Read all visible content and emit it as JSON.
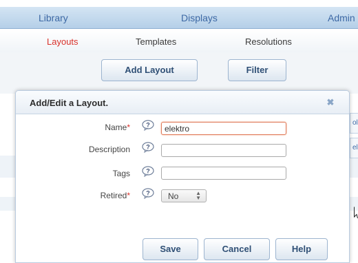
{
  "topnav": {
    "items": [
      "Library",
      "Displays",
      "Admin"
    ]
  },
  "subnav": {
    "items": [
      "Layouts",
      "Templates",
      "Resolutions"
    ],
    "active": "Layouts"
  },
  "actions": {
    "add_layout": "Add Layout",
    "filter": "Filter"
  },
  "dialog": {
    "title": "Add/Edit a Layout.",
    "close": "✖",
    "fields": {
      "name": {
        "label": "Name",
        "required": "*",
        "value": "elektro"
      },
      "description": {
        "label": "Description",
        "value": ""
      },
      "tags": {
        "label": "Tags",
        "value": ""
      },
      "retired": {
        "label": "Retired",
        "required": "*",
        "value": "No"
      }
    },
    "buttons": {
      "save": "Save",
      "cancel": "Cancel",
      "help": "Help"
    }
  },
  "background": {
    "tab1": "ol",
    "tab2": "el"
  },
  "icons": {
    "help": "help-question-icon",
    "close": "close-icon",
    "cursor": "mouse-pointer-icon"
  },
  "colors": {
    "accent": "#d9312a",
    "nav_text": "#3c68a4",
    "button_text": "#2f4f75"
  }
}
